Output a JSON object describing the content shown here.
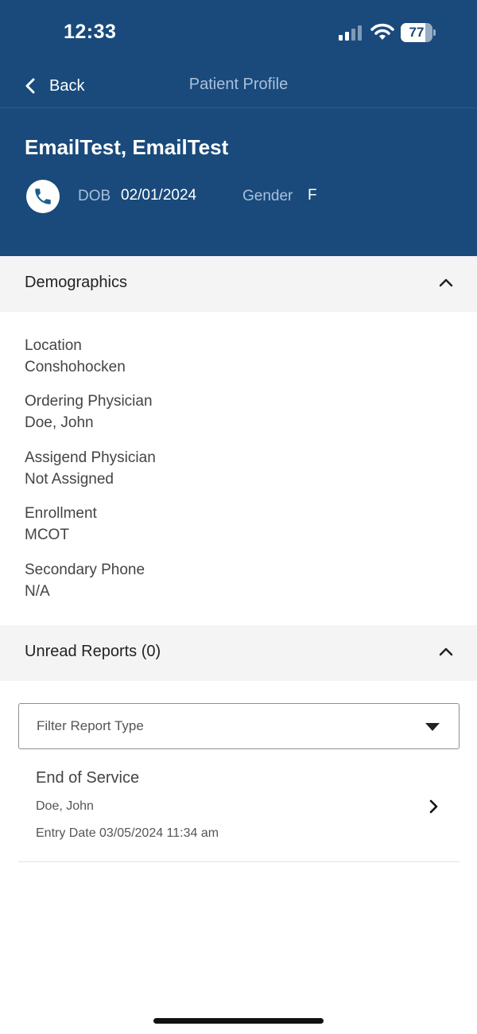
{
  "status_bar": {
    "time": "12:33",
    "battery_percent": "77",
    "battery_level": 0.77,
    "signal_bars_active": 2,
    "icons": [
      "cellular-signal-icon",
      "wifi-icon",
      "battery-icon"
    ]
  },
  "navbar": {
    "back_label": "Back",
    "title": "Patient Profile",
    "back_icon": "chevron-left-icon"
  },
  "patient": {
    "name": "EmailTest, EmailTest",
    "dob_label": "DOB",
    "dob": "02/01/2024",
    "gender_label": "Gender",
    "gender": "F",
    "phone_icon": "phone-icon"
  },
  "demographics": {
    "title": "Demographics",
    "fields": [
      {
        "label": "Location",
        "value": "Conshohocken"
      },
      {
        "label": "Ordering Physician",
        "value": "Doe, John"
      },
      {
        "label": "Assigend Physician",
        "value": "Not Assigned"
      },
      {
        "label": "Enrollment",
        "value": "MCOT"
      },
      {
        "label": "Secondary Phone",
        "value": "N/A"
      }
    ]
  },
  "unread_reports": {
    "title": "Unread Reports (0)",
    "filter_placeholder": "Filter Report Type",
    "reports": [
      {
        "title": "End of Service",
        "physician": "Doe, John",
        "entry_date": "Entry Date 03/05/2024 11:34 am"
      }
    ]
  },
  "colors": {
    "header_bg": "#194a7b",
    "header_muted_text": "#a9c0dc",
    "section_bg": "#f4f4f4",
    "phone_icon": "#1d5e8f"
  }
}
